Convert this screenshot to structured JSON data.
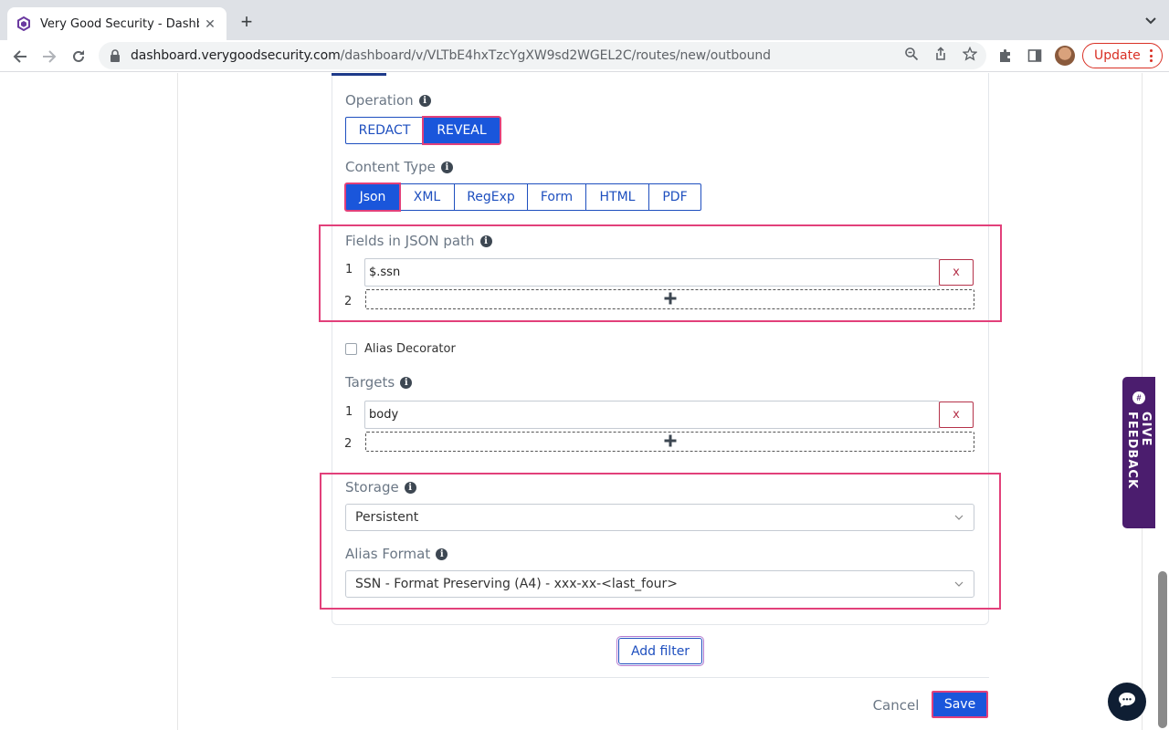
{
  "browser": {
    "tab_title": "Very Good Security - Dashboar",
    "url_host": "dashboard.verygoodsecurity.com",
    "url_path": "/dashboard/v/VLTbE4hxTzcYgXW9sd2WGEL2C/routes/new/outbound",
    "update_label": "Update"
  },
  "form": {
    "operation": {
      "label": "Operation",
      "options": [
        "REDACT",
        "REVEAL"
      ],
      "selected": "REVEAL"
    },
    "content_type": {
      "label": "Content Type",
      "options": [
        "Json",
        "XML",
        "RegExp",
        "Form",
        "HTML",
        "PDF"
      ],
      "selected": "Json"
    },
    "fields": {
      "label": "Fields in JSON path",
      "rows": [
        {
          "num": "1",
          "value": "$.ssn",
          "remove": "x"
        },
        {
          "num": "2"
        }
      ]
    },
    "alias_decorator": {
      "label": "Alias Decorator",
      "checked": false
    },
    "targets": {
      "label": "Targets",
      "rows": [
        {
          "num": "1",
          "value": "body",
          "remove": "x"
        },
        {
          "num": "2"
        }
      ]
    },
    "storage": {
      "label": "Storage",
      "value": "Persistent"
    },
    "alias_format": {
      "label": "Alias Format",
      "value": "SSN - Format Preserving (A4) - xxx-xx-<last_four>"
    },
    "add_filter_label": "Add filter",
    "cancel_label": "Cancel",
    "save_label": "Save"
  },
  "feedback": {
    "label": "GIVE FEEDBACK"
  },
  "colors": {
    "primary": "#1a56db",
    "highlight": "#e2407a",
    "feedback_bg": "#4b1d6e",
    "danger": "#b5324a"
  }
}
